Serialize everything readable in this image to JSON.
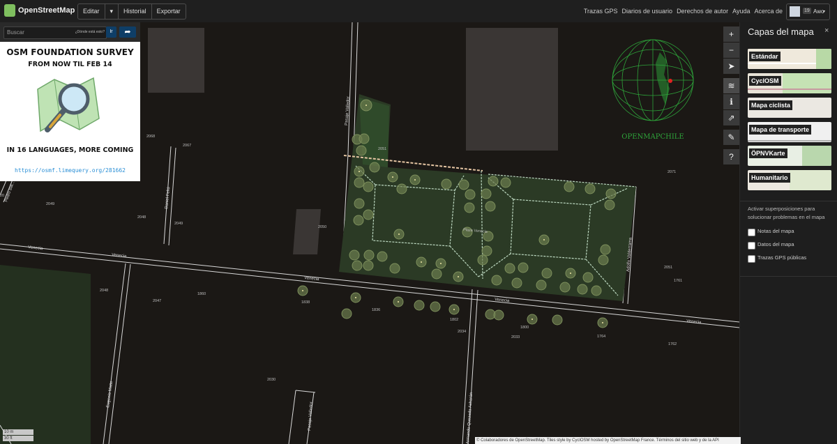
{
  "header": {
    "brand": "OpenStreetMap",
    "edit": "Editar",
    "edit_caret": "▾",
    "history": "Historial",
    "export": "Exportar",
    "links": [
      "Trazas GPS",
      "Diarios de usuario",
      "Derechos de autor",
      "Ayuda",
      "Acerca de"
    ],
    "user_badge": "19",
    "user_name": "Awo",
    "user_caret": "▾"
  },
  "search": {
    "placeholder": "Buscar",
    "where": "¿Dónde está esto?",
    "go": "Ir"
  },
  "banner": {
    "line1": "OSM FOUNDATION SURVEY",
    "line2": "FROM NOW TIL FEB 14",
    "line3": "IN 16 LANGUAGES, MORE COMING",
    "url": "https://osmf.limequery.org/281662"
  },
  "controls": [
    "+",
    "−",
    "➤",
    "≋",
    "ℹ",
    "⇗",
    "✎",
    "?"
  ],
  "logo_text": "OPENMAPCHILE",
  "panel": {
    "title": "Capas del mapa",
    "close": "×",
    "layers": [
      "Estándar",
      "CyclOSM",
      "Mapa ciclista",
      "Mapa de transporte",
      "ÖPNVKarte",
      "Humanitario"
    ],
    "overlay_intro": "Activar superposiciones para solucionar problemas en el mapa",
    "overlays": [
      "Notas del mapa",
      "Datos del mapa",
      "Trazas GPS públicas"
    ]
  },
  "map": {
    "streets": {
      "venecia": "Venecia",
      "pasaje_valledor": "Pasaje Valledor",
      "pasaje_valledor_2": "Pasaje Valledor",
      "adolfo": "Adolfo Valderrama",
      "daniel": "Daniel Feliú",
      "pedro": "Pedro Bal...",
      "eugenio": "Eugenio Matte",
      "quezada": "Armando Quezada Acharán",
      "plaza": "Plaza Venecia"
    },
    "numbers": [
      "2068",
      "2067",
      "2049",
      "2048",
      "2049",
      "2051",
      "2050",
      "2071",
      "2048",
      "2047",
      "1860",
      "1838",
      "1836",
      "1802",
      "2034",
      "1800",
      "2033",
      "1764",
      "1762",
      "2051",
      "1761",
      "2030",
      "20"
    ]
  },
  "scale": {
    "metric": "10 m",
    "imperial": "30 ft"
  },
  "attribution": "© Colaboradores de OpenStreetMap. Tiles style by CyclOSM hosted by OpenStreetMap France. Términos del sitio web y de la API"
}
